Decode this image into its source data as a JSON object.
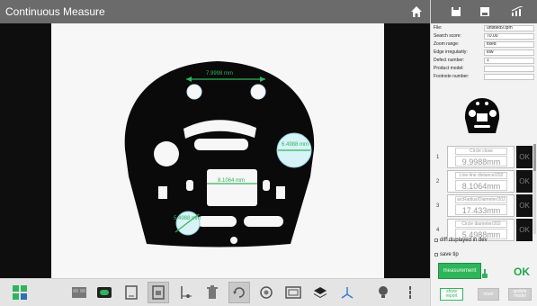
{
  "window": {
    "title": "Continuous Measure"
  },
  "settings": [
    {
      "label": "File:",
      "value": "untitled9.tpm"
    },
    {
      "label": "Search score:",
      "value": "70.00"
    },
    {
      "label": "Zoom range:",
      "value": "fixed"
    },
    {
      "label": "Edge irregularity:",
      "value": "low"
    },
    {
      "label": "Defect number:",
      "value": "1"
    },
    {
      "label": "Product model:",
      "value": ""
    },
    {
      "label": "Footnote number:",
      "value": ""
    }
  ],
  "measurements": [
    {
      "index": "1",
      "name": "Circle close",
      "value": "9.9988mm",
      "status": "OK"
    },
    {
      "index": "2",
      "name": "Line-line distance/202",
      "value": "8.1064mm",
      "status": "OK"
    },
    {
      "index": "3",
      "name": "arcRadius/Diameter/202",
      "value": "17.433mm",
      "status": "OK"
    },
    {
      "index": "4",
      "name": "Circle diameter/202",
      "value": "5.4988mm",
      "status": "OK"
    }
  ],
  "options": {
    "diff_label": "diff displayed in dev",
    "save_label": "save tip"
  },
  "actions": {
    "measure_label": "measurement",
    "result": "OK",
    "show_label": "show report",
    "reset_label": "reset",
    "update_label": "update model"
  },
  "overlay_labels": {
    "top": "7.9998 mm",
    "right": "6.4988 mm",
    "center": "8.1064 mm",
    "bottom_left": "5.4988 mm"
  },
  "colors": {
    "measure_green": "#2fb45a",
    "overlay_green": "#2fb45a",
    "part_fill": "#0a0a0a",
    "highlight": "#d8f3f7"
  }
}
